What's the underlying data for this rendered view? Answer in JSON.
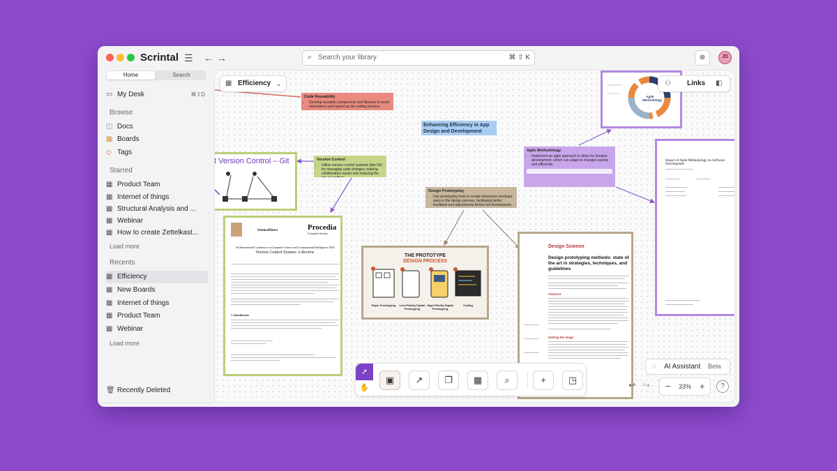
{
  "app": {
    "name": "Scrintal",
    "avatar_initials": "JD"
  },
  "titlebar": {
    "search_placeholder": "Search your library",
    "search_shortcut": "⌘ ⇧ K"
  },
  "sidebar": {
    "tabs": [
      "Home",
      "Search"
    ],
    "my_desk": {
      "label": "My Desk",
      "shortcut": "⌘⇧D"
    },
    "browse_title": "Browse",
    "browse": [
      "Docs",
      "Boards",
      "Tags"
    ],
    "starred_title": "Starred",
    "starred": [
      "Product Team",
      "Internet of things",
      "Structural Analysis and ...",
      "Webinar",
      "How to create Zettelkast..."
    ],
    "recents_title": "Recents",
    "recents": [
      "Efficiency",
      "New Boards",
      "Internet of things",
      "Product Team",
      "Webinar"
    ],
    "load_more": "Load more",
    "recently_deleted": "Recently Deleted"
  },
  "canvas": {
    "board_name": "Efficiency",
    "links_label": "Links",
    "title_note": "Enhancing Efficiency in App Design and Development",
    "notes": [
      {
        "title": "Code Reusability",
        "body": "Develop reusable components and libraries to avoid redundancy and speed up the coding process.",
        "color": "#e88a80"
      },
      {
        "title": "Version Control",
        "body": "Utilize version control systems (like Git) for managing code changes, making collaboration easier and reducing the risk of conflicts.",
        "color": "#c5d58a"
      },
      {
        "title": "Design Prototyping",
        "body": "Use prototyping tools to create interactive mockups early in the design process, facilitating better feedback and adjustments before full development.",
        "color": "#c7b79c"
      },
      {
        "title": "Agile Methodology",
        "body": "Implement an agile approach to allow for iterative development, which can adapt to changes quickly and efficiently.",
        "color": "#c9a6ea"
      }
    ],
    "git_card_title": "t Version Control – Git",
    "paper1": {
      "publisher": "ScienceDirect",
      "journal": "Procedia",
      "journal_sub": "Computer Science",
      "conference": "3rd International Conference on Computer Science and Computational Intelligence 2018",
      "title": "Version Control System: A Review",
      "section": "1. Introduction"
    },
    "prototype": {
      "heading1": "THE PROTOTYPE",
      "heading2": "DESIGN PROCESS",
      "stages": [
        "Paper Prototyping",
        "Low-Fidelity Digital Prototyping",
        "High-Fidelity Digital Prototyping",
        "Coding"
      ]
    },
    "paper2": {
      "journal": "Design Science",
      "title": "Design prototyping methods: state of the art in strategies, techniques, and guidelines",
      "abstract": "Abstract",
      "section": "Setting the stage"
    },
    "agile_title": "Agile Methodology",
    "paper3_title": "Impact of Agile Methodology on Software Development"
  },
  "toolbar": {
    "tools": [
      "new-card",
      "arrow",
      "cards",
      "boards",
      "search-library",
      "add",
      "layout"
    ]
  },
  "ai": {
    "label": "AI Assistant",
    "badge": "Beta"
  },
  "zoom": {
    "level": "33%"
  },
  "colors": {
    "accent": "#7b42c7",
    "background": "#8d4bcc"
  }
}
